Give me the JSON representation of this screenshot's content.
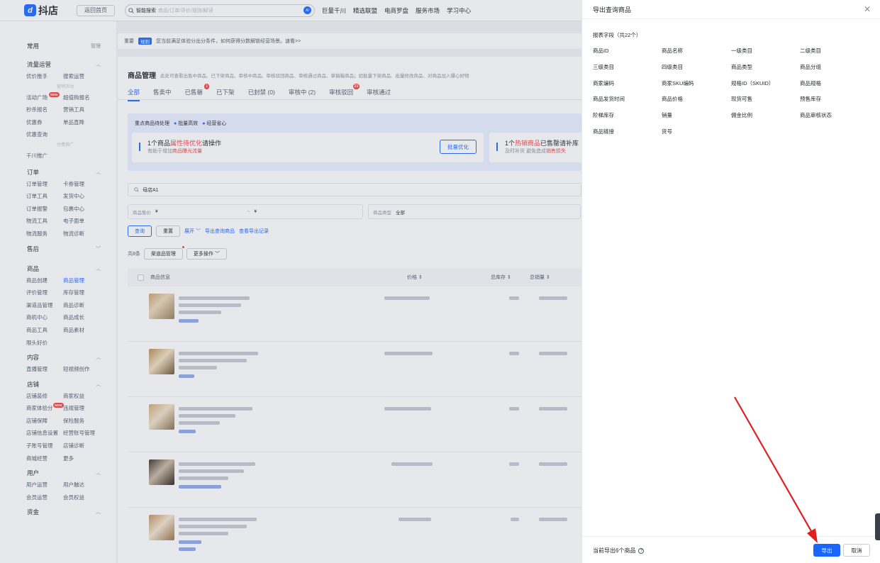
{
  "topbar": {
    "logo_text": "抖店",
    "back_home": "返回首页",
    "search_label": "智能搜索",
    "search_placeholder": "商品/订单/评价/规则/解读",
    "ai_label": "AI",
    "nav": [
      "巨量千川",
      "精选联盟",
      "电商罗盘",
      "服务市场",
      "学习中心"
    ]
  },
  "sidebar": {
    "groups": [
      {
        "title": "常用",
        "extra": "管理",
        "items": []
      },
      {
        "title": "流量运营",
        "items": [
          "优价推手",
          "搜索运营"
        ],
        "divider": "营销活动",
        "items2": [
          "活动广场",
          "超值购报名",
          "秒杀报名",
          "营销工具",
          "优惠券",
          "单品直降",
          "优惠查询"
        ],
        "divider2": "付费推广",
        "items3": [
          "千川推广"
        ]
      },
      {
        "title": "订单",
        "items": [
          "订单管理",
          "卡券管理",
          "订单工具",
          "发货中心",
          "订单报警",
          "包裹中心",
          "物流工具",
          "电子面单",
          "物流服务",
          "物流诊断"
        ]
      },
      {
        "title": "售后",
        "items": []
      },
      {
        "title": "商品",
        "items": [
          "商品创建",
          "商品管理",
          "评价管理",
          "库存管理",
          "渠道品管理",
          "商品诊断",
          "商机中心",
          "商品成长",
          "商品工具",
          "商品素材",
          "限头好价"
        ]
      },
      {
        "title": "内容",
        "items": [
          "直播管理",
          "短视频创作"
        ]
      },
      {
        "title": "店铺",
        "items": [
          "店铺装修",
          "商家权益",
          "商家体验分",
          "违规管理",
          "店铺保障",
          "保险服务",
          "店铺信息设置",
          "经营账号管理",
          "子账号管理",
          "店铺诊断",
          "商城经营",
          "更多"
        ]
      },
      {
        "title": "用户",
        "items": [
          "用户运营",
          "用户触达",
          "会员运营",
          "会员权益"
        ]
      },
      {
        "title": "资金",
        "items": []
      }
    ],
    "new_tag": "NEW"
  },
  "notice": {
    "tag_left": "重要",
    "tag": "规则",
    "text": "您当前满足体验分出分条件，如何获得分数解锁经营场景。速看>>"
  },
  "page": {
    "title": "商品管理",
    "subtitle": "此处可查看出售中商品、已下架商品、审核中商品、审核驳回商品、审核通过商品、草稿箱商品；如批量下架商品、批量修改商品、对商品加入爆心好物",
    "tabs": [
      {
        "label": "全部",
        "badge": ""
      },
      {
        "label": "售卖中",
        "badge": ""
      },
      {
        "label": "已售罄",
        "badge": "1"
      },
      {
        "label": "已下架",
        "badge": ""
      },
      {
        "label": "已封禁 (0)",
        "badge": ""
      },
      {
        "label": "审核中 (2)",
        "badge": ""
      },
      {
        "label": "审核驳回",
        "badge": "23"
      },
      {
        "label": "审核通过",
        "badge": ""
      }
    ]
  },
  "key_panel": {
    "title": "重点商品待处理",
    "opt1": "批量高效",
    "opt2": "经营省心",
    "box1": {
      "pre": "1个商品",
      "hl": "属性待优化",
      "post": "请操作",
      "sub_pre": "有助于增加",
      "sub_hl": "商品曝光流量",
      "button": "批量优化"
    },
    "box2": {
      "pre": "1个",
      "hl": "热销商品",
      "post": "已售罄请补库",
      "sub_pre": "及时补货 避免造成",
      "sub_hl": "销售损失"
    }
  },
  "filters": {
    "search_value": "母店A1",
    "price_label": "商品售价",
    "price_from": "¥",
    "price_sep": "~",
    "price_to": "¥",
    "type_label": "商品类型",
    "type_value": "全部"
  },
  "actions": {
    "query": "查询",
    "reset": "重置",
    "expand": "展开",
    "export_link": "导出查询商品",
    "view_export": "查看导出记录"
  },
  "toolbar": {
    "total": "共8条",
    "channel_btn": "渠道品管理",
    "more_btn": "更多操作"
  },
  "table": {
    "headers": [
      "商品信息",
      "价格",
      "总库存",
      "总销量"
    ]
  },
  "drawer": {
    "title": "导出查询商品",
    "subtitle": "报表字段（共22个）",
    "fields": [
      "商品ID",
      "商品名称",
      "一级类目",
      "二级类目",
      "三级类目",
      "四级类目",
      "商品类型",
      "商品分组",
      "商家编码",
      "商家SKU编码",
      "规格ID（SKUID）",
      "商品规格",
      "商品发货时间",
      "商品价格",
      "现货可售",
      "预售库存",
      "阶梯库存",
      "销量",
      "佣金比例",
      "商品审核状态",
      "商品链接",
      "货号"
    ],
    "footer_count": "当前导出6个商品",
    "export_btn": "导出",
    "cancel_btn": "取消"
  },
  "colors": {
    "accent": "#1966ff",
    "alert": "#f53f3f",
    "annotation": "#e02020"
  }
}
